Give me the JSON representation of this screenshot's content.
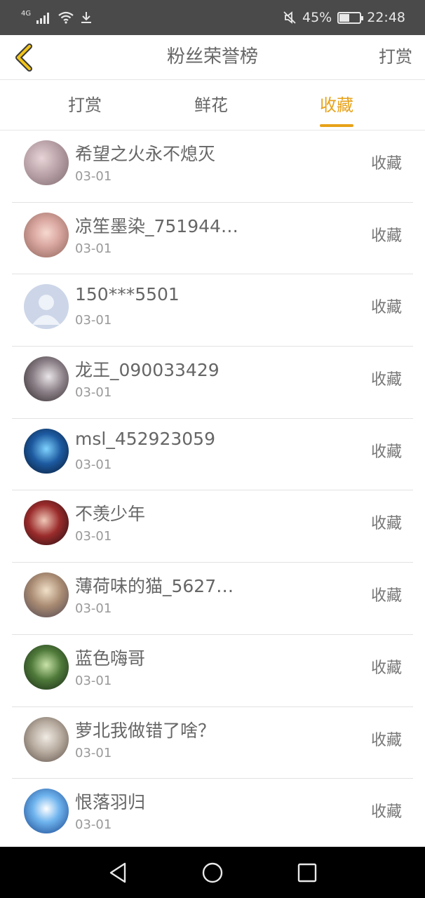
{
  "status_bar": {
    "network": "4G",
    "battery_text": "45%",
    "time": "22:48",
    "icons": [
      "signal-icon",
      "wifi-icon",
      "download-icon",
      "mute-icon",
      "battery-icon"
    ]
  },
  "header": {
    "title": "粉丝荣誉榜",
    "action": "打赏",
    "back_icon": "chevron-left-icon"
  },
  "tabs": [
    {
      "label": "打赏",
      "active": false
    },
    {
      "label": "鲜花",
      "active": false
    },
    {
      "label": "收藏",
      "active": true
    }
  ],
  "accent_color": "#e8a21a",
  "list": [
    {
      "name": "希望之火永不熄灭",
      "date": "03-01",
      "action": "收藏"
    },
    {
      "name": "凉笙墨染_751944…",
      "date": "03-01",
      "action": "收藏"
    },
    {
      "name": "150***5501",
      "date": "03-01",
      "action": "收藏"
    },
    {
      "name": "龙王_090033429",
      "date": "03-01",
      "action": "收藏"
    },
    {
      "name": "msl_452923059",
      "date": "03-01",
      "action": "收藏"
    },
    {
      "name": "不羡少年",
      "date": "03-01",
      "action": "收藏"
    },
    {
      "name": "薄荷味的猫_5627…",
      "date": "03-01",
      "action": "收藏"
    },
    {
      "name": "蓝色嗨哥",
      "date": "03-01",
      "action": "收藏"
    },
    {
      "name": "萝北我做错了啥？",
      "date": "03-01",
      "action": "收藏"
    },
    {
      "name": "恨落羽归",
      "date": "03-01",
      "action": "收藏"
    }
  ],
  "nav_bar": {
    "icons": [
      "back-triangle-icon",
      "home-circle-icon",
      "recents-square-icon"
    ]
  }
}
